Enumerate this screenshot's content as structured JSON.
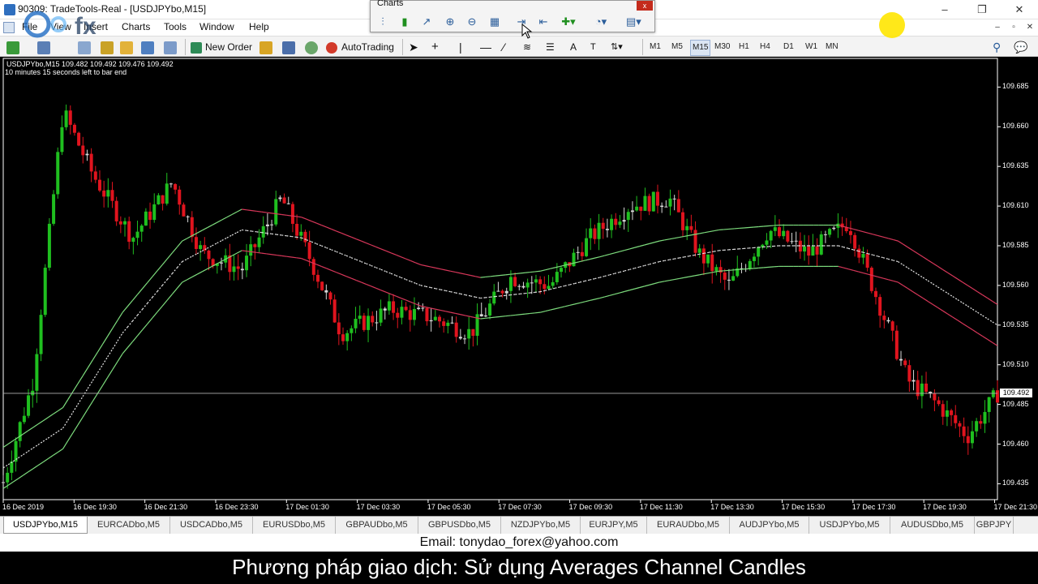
{
  "window": {
    "title": "90309: TradeTools-Real - [USDJPYbo,M15]",
    "controls": [
      "–",
      "❐",
      "✕"
    ]
  },
  "menu": [
    "File",
    "View",
    "Insert",
    "Charts",
    "Tools",
    "Window",
    "Help"
  ],
  "mdi_controls": [
    "–",
    "▫",
    "✕"
  ],
  "toolbar": {
    "new_order": "New Order",
    "autotrading": "AutoTrading",
    "text_tool": "A",
    "timeframes": [
      "M1",
      "M5",
      "M15",
      "M30",
      "H1",
      "H4",
      "D1",
      "W1",
      "MN"
    ],
    "active_timeframe": "M15"
  },
  "charts_toolbar": {
    "title": "Charts",
    "close": "x"
  },
  "chart": {
    "symbol_info": "USDJPYbo,M15  109.482 109.492 109.476 109.492",
    "countdown": "10 minutes 15 seconds left to bar end",
    "current_price": "109.492",
    "bg_color": "#000000",
    "bull_color": "#1fbf1f",
    "bear_color": "#e0141e",
    "doji_color": "#d8d8d8"
  },
  "chart_data": {
    "type": "candlestick",
    "title": "USDJPYbo,M15",
    "price_ticks": [
      "109.685",
      "109.660",
      "109.635",
      "109.610",
      "109.585",
      "109.560",
      "109.535",
      "109.510",
      "109.485",
      "109.460",
      "109.435"
    ],
    "time_ticks": [
      "16 Dec 2019",
      "16 Dec 19:30",
      "16 Dec 21:30",
      "16 Dec 23:30",
      "17 Dec 01:30",
      "17 Dec 03:30",
      "17 Dec 05:30",
      "17 Dec 07:30",
      "17 Dec 09:30",
      "17 Dec 11:30",
      "17 Dec 13:30",
      "17 Dec 15:30",
      "17 Dec 17:30",
      "17 Dec 19:30",
      "17 Dec 21:30"
    ],
    "ylim": [
      109.425,
      109.7
    ],
    "last_quote": {
      "bid": 109.482,
      "high": 109.492,
      "low": 109.476,
      "close": 109.492
    },
    "close_path": [
      {
        "t": 0.0,
        "v": 109.436
      },
      {
        "t": 0.03,
        "v": 109.5
      },
      {
        "t": 0.06,
        "v": 109.67
      },
      {
        "t": 0.09,
        "v": 109.63
      },
      {
        "t": 0.13,
        "v": 109.59
      },
      {
        "t": 0.17,
        "v": 109.625
      },
      {
        "t": 0.2,
        "v": 109.58
      },
      {
        "t": 0.24,
        "v": 109.57
      },
      {
        "t": 0.28,
        "v": 109.615
      },
      {
        "t": 0.31,
        "v": 109.575
      },
      {
        "t": 0.34,
        "v": 109.53
      },
      {
        "t": 0.39,
        "v": 109.545
      },
      {
        "t": 0.43,
        "v": 109.54
      },
      {
        "t": 0.47,
        "v": 109.53
      },
      {
        "t": 0.51,
        "v": 109.565
      },
      {
        "t": 0.55,
        "v": 109.56
      },
      {
        "t": 0.59,
        "v": 109.59
      },
      {
        "t": 0.63,
        "v": 109.61
      },
      {
        "t": 0.67,
        "v": 109.615
      },
      {
        "t": 0.7,
        "v": 109.58
      },
      {
        "t": 0.73,
        "v": 109.56
      },
      {
        "t": 0.77,
        "v": 109.595
      },
      {
        "t": 0.81,
        "v": 109.58
      },
      {
        "t": 0.85,
        "v": 109.6
      },
      {
        "t": 0.88,
        "v": 109.55
      },
      {
        "t": 0.91,
        "v": 109.5
      },
      {
        "t": 0.94,
        "v": 109.485
      },
      {
        "t": 0.97,
        "v": 109.465
      },
      {
        "t": 1.0,
        "v": 109.492
      }
    ],
    "ma_mid_path": [
      {
        "t": 0.0,
        "v": 109.445
      },
      {
        "t": 0.06,
        "v": 109.47
      },
      {
        "t": 0.12,
        "v": 109.53
      },
      {
        "t": 0.18,
        "v": 109.575
      },
      {
        "t": 0.24,
        "v": 109.595
      },
      {
        "t": 0.3,
        "v": 109.59
      },
      {
        "t": 0.36,
        "v": 109.575
      },
      {
        "t": 0.42,
        "v": 109.56
      },
      {
        "t": 0.48,
        "v": 109.552
      },
      {
        "t": 0.54,
        "v": 109.556
      },
      {
        "t": 0.6,
        "v": 109.565
      },
      {
        "t": 0.66,
        "v": 109.575
      },
      {
        "t": 0.72,
        "v": 109.582
      },
      {
        "t": 0.78,
        "v": 109.585
      },
      {
        "t": 0.84,
        "v": 109.585
      },
      {
        "t": 0.9,
        "v": 109.575
      },
      {
        "t": 0.95,
        "v": 109.555
      },
      {
        "t": 1.0,
        "v": 109.535
      }
    ],
    "channel_width": 0.013
  },
  "tabs": [
    "USDJPYbo,M15",
    "EURCADbo,M5",
    "USDCADbo,M5",
    "EURUSDbo,M5",
    "GBPAUDbo,M5",
    "GBPUSDbo,M5",
    "NZDJPYbo,M5",
    "EURJPY,M5",
    "EURAUDbo,M5",
    "AUDJPYbo,M5",
    "USDJPYbo,M5",
    "AUDUSDbo,M5",
    "GBPJPY"
  ],
  "active_tab": "USDJPYbo,M15",
  "footer": {
    "email": "Email: tonydao_forex@yahoo.com",
    "caption": "Phương pháp giao dịch: Sử dụng Averages Channel Candles"
  },
  "logo_text": "fx"
}
